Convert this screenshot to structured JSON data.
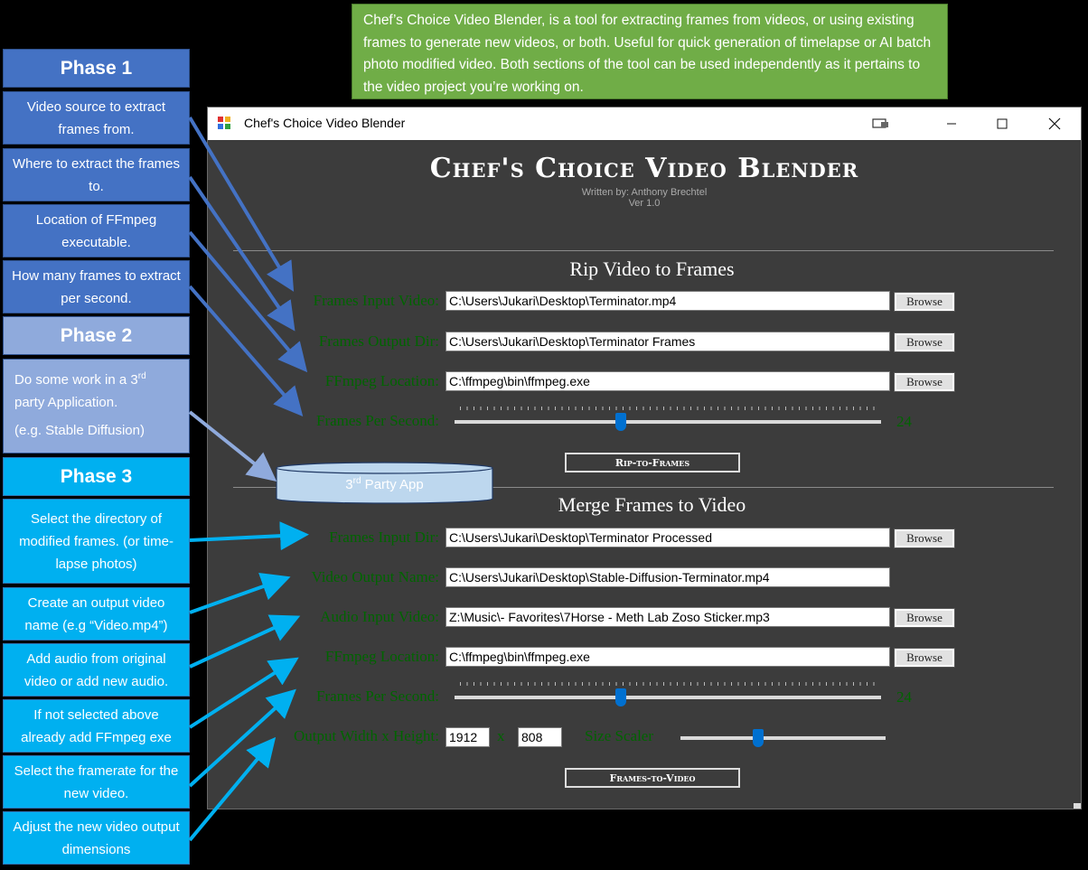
{
  "info_text": "Chef’s Choice Video Blender, is a tool for extracting frames from videos, or using existing frames to generate new videos, or both. Useful for quick generation of timelapse or AI batch photo modified video. Both sections of the tool can be used independently as it pertains to the video project you’re working on.",
  "phases": {
    "phase1": {
      "title": "Phase 1",
      "items": [
        "Video source to extract frames from.",
        "Where to extract the frames to.",
        "Location of FFmpeg executable.",
        "How many frames to extract per second."
      ]
    },
    "phase2": {
      "title": "Phase 2",
      "line1_pre": "Do some work in a 3",
      "line1_sup": "rd",
      "line1_post": " party Application.",
      "line2": "(e.g. Stable Diffusion)"
    },
    "phase3": {
      "title": "Phase 3",
      "items": [
        "Select the directory of modified frames. (or time-lapse photos)",
        "Create an output video name (e.g “Video.mp4”)",
        "Add audio from original video or add new audio.",
        "If not selected above already add FFmpeg exe",
        "Select the framerate for the new video.",
        "Adjust the new video output dimensions"
      ]
    }
  },
  "third_party": {
    "pre": "3",
    "sup": "rd",
    "post": " Party App"
  },
  "window": {
    "title": "Chef's Choice Video Blender",
    "app_title": "Chef's Choice Video Blender",
    "author": "Written by: Anthony Brechtel",
    "version": "Ver 1.0"
  },
  "rip": {
    "title": "Rip Video to Frames",
    "input_label": "Frames Input Video:",
    "input_value": "C:\\Users\\Jukari\\Desktop\\Terminator.mp4",
    "output_label": "Frames Output Dir:",
    "output_value": "C:\\Users\\Jukari\\Desktop\\Terminator Frames",
    "ffmpeg_label": "FFmpeg Location:",
    "ffmpeg_value": "C:\\ffmpeg\\bin\\ffmpeg.exe",
    "fps_label": "Frames Per Second:",
    "fps_value": "24",
    "fps_level": 0.39,
    "button": "Rip-to-Frames"
  },
  "merge": {
    "title": "Merge Frames to Video",
    "input_label": "Frames Input Dir:",
    "input_value": "C:\\Users\\Jukari\\Desktop\\Terminator Processed",
    "output_label": "Video Output Name:",
    "output_value": "C:\\Users\\Jukari\\Desktop\\Stable-Diffusion-Terminator.mp4",
    "audio_label": "Audio Input Video:",
    "audio_value": "Z:\\Music\\- Favorites\\7Horse - Meth Lab Zoso Sticker.mp3",
    "ffmpeg_label": "FFmpeg Location:",
    "ffmpeg_value": "C:\\ffmpeg\\bin\\ffmpeg.exe",
    "fps_label": "Frames Per Second:",
    "fps_value": "24",
    "fps_level": 0.39,
    "size_label": "Output Width x Height:",
    "width_value": "1912",
    "x_label": "x",
    "height_value": "808",
    "scaler_label": "Size Scaler",
    "scaler_level": 0.38,
    "button": "Frames-to-Video"
  },
  "browse_label": "Browse",
  "colors": {
    "info_bg": "#70ad47",
    "phase1": "#4472c4",
    "phase2": "#8faadc",
    "phase3": "#00b0f0",
    "window_bg": "#3c3c3c",
    "label_green": "#006400",
    "slider_thumb": "#0070d0"
  }
}
